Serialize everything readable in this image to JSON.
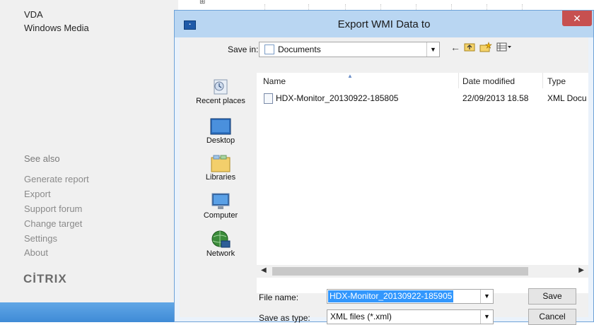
{
  "background_app": {
    "nav_items": [
      "VDA",
      "Windows Media"
    ],
    "see_also_label": "See also",
    "links": [
      "Generate report",
      "Export",
      "Support forum",
      "Change target",
      "Settings",
      "About"
    ],
    "logo_text": "CİTRIX",
    "toolbar_glyph": "⊞"
  },
  "dialog": {
    "title": "Export WMI Data to",
    "close_glyph": "✕",
    "save_in": {
      "label": "Save in:",
      "value": "Documents"
    },
    "nav_icons": [
      "back-arrow-icon",
      "up-folder-icon",
      "new-folder-icon",
      "view-menu-icon"
    ],
    "places": [
      "Recent places",
      "Desktop",
      "Libraries",
      "Computer",
      "Network"
    ],
    "columns": [
      "Name",
      "Date modified",
      "Type"
    ],
    "files": [
      {
        "name": "HDX-Monitor_20130922-185805",
        "date": "22/09/2013 18.58",
        "type": "XML Docu"
      }
    ],
    "file_name": {
      "label": "File name:",
      "value": "HDX-Monitor_20130922-185905"
    },
    "save_as_type": {
      "label": "Save as type:",
      "value": "XML files (*.xml)"
    },
    "buttons": {
      "save": "Save",
      "cancel": "Cancel"
    }
  },
  "colors": {
    "title_bar": "#b9d6f2",
    "close_button": "#c75050",
    "selection": "#3297fd",
    "taskbar": "#4a95dc"
  }
}
